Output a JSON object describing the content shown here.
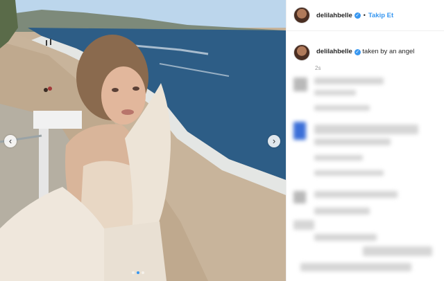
{
  "post": {
    "username": "delilahbelle",
    "follow_label": "Takip Et",
    "separator": "•",
    "caption": "taken by an angel",
    "time": "2s"
  },
  "carousel": {
    "prev_label": "‹",
    "next_label": "›",
    "slide_count": 3,
    "active_slide": 2
  },
  "colors": {
    "accent": "#3897f0",
    "sea": "#2d5d86",
    "sand": "#c8b49b",
    "sky": "#bcd6ec"
  },
  "icons": {
    "verified": "verified-badge-icon",
    "prev": "chevron-left-icon",
    "next": "chevron-right-icon"
  }
}
